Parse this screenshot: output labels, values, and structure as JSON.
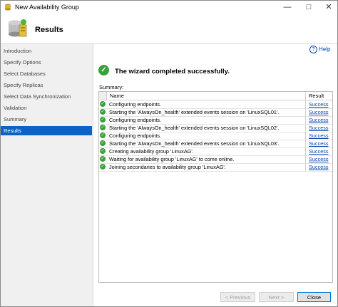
{
  "window": {
    "title": "New Availability Group"
  },
  "header": {
    "title": "Results"
  },
  "sidebar": {
    "items": [
      {
        "label": "Introduction"
      },
      {
        "label": "Specify Options"
      },
      {
        "label": "Select Databases"
      },
      {
        "label": "Specify Replicas"
      },
      {
        "label": "Select Data Synchronization"
      },
      {
        "label": "Validation"
      },
      {
        "label": "Summary"
      },
      {
        "label": "Results",
        "active": true
      }
    ]
  },
  "help": {
    "label": "Help"
  },
  "banner": {
    "text": "The wizard completed successfully."
  },
  "summary": {
    "label": "Summary:",
    "columns": {
      "name": "Name",
      "result": "Result"
    },
    "rows": [
      {
        "name": "Configuring endpoints.",
        "result": "Success"
      },
      {
        "name": "Starting the 'AlwaysOn_health' extended events session on 'LinuxSQL01'.",
        "result": "Success"
      },
      {
        "name": "Configuring endpoints.",
        "result": "Success"
      },
      {
        "name": "Starting the 'AlwaysOn_health' extended events session on 'LinuxSQL02'.",
        "result": "Success"
      },
      {
        "name": "Configuring endpoints.",
        "result": "Success"
      },
      {
        "name": "Starting the 'AlwaysOn_health' extended events session on 'LinuxSQL03'.",
        "result": "Success"
      },
      {
        "name": "Creating availability group 'LinuxAG'.",
        "result": "Success"
      },
      {
        "name": "Waiting for availability group 'LinuxAG' to come online.",
        "result": "Success"
      },
      {
        "name": "Joining secondaries to availability group 'LinuxAG'.",
        "result": "Success"
      }
    ]
  },
  "buttons": {
    "previous": "< Previous",
    "next": "Next >",
    "close": "Close"
  },
  "colors": {
    "accent": "#0a64c8",
    "success": "#3aa03a",
    "link": "#0645ad"
  }
}
